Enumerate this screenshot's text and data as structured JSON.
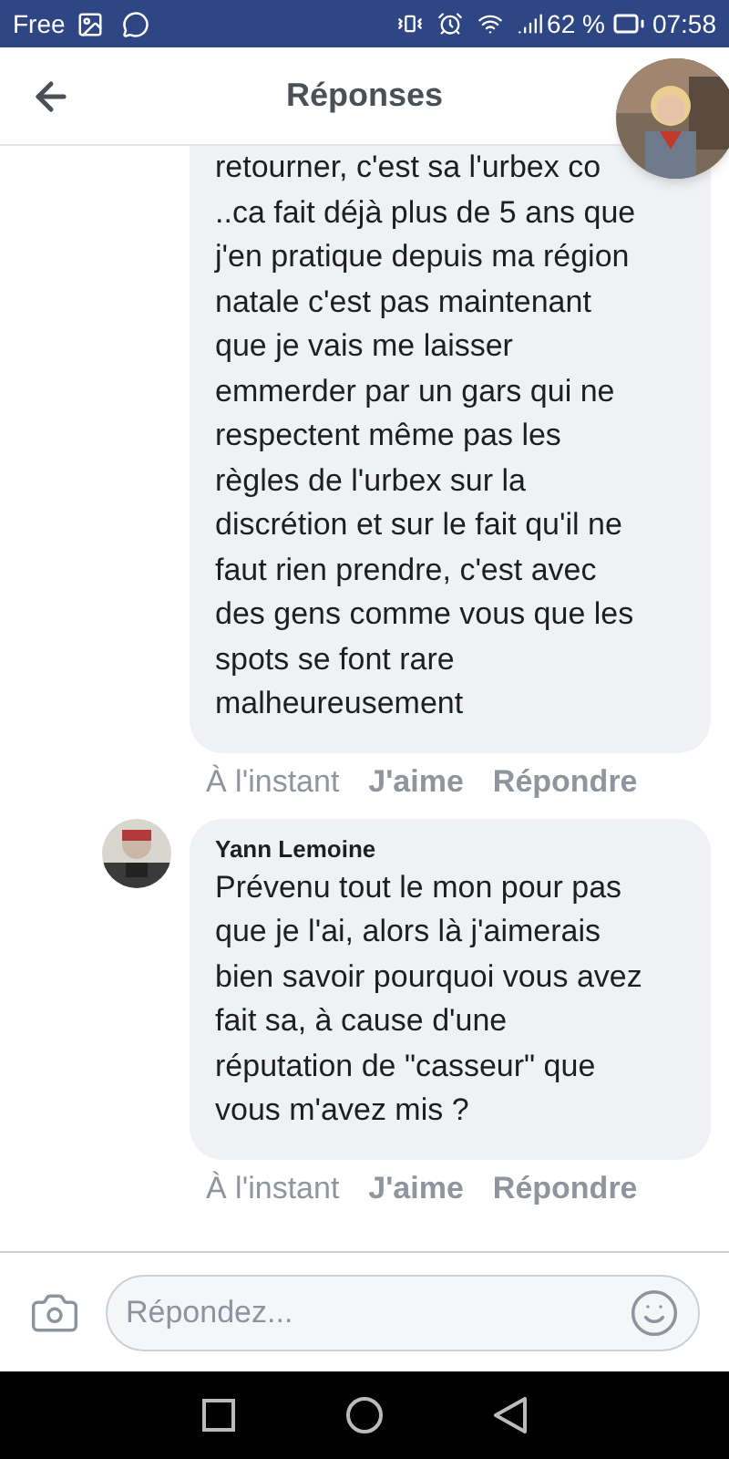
{
  "status_bar": {
    "carrier": "Free",
    "battery": "62 %",
    "time": "07:58"
  },
  "header": {
    "title": "Réponses"
  },
  "comments": [
    {
      "lines": [
        "retourner, c'est sa l'urbex co",
        "..ca fait déjà plus de 5 ans que",
        "j'en pratique depuis ma région",
        "natale c'est pas maintenant",
        "que je vais me laisser",
        "emmerder par un gars qui ne",
        "respectent même pas les",
        "règles de l'urbex sur la",
        "discrétion et sur le fait qu'il ne",
        "faut rien prendre, c'est avec",
        "des gens comme vous que les",
        "spots se font rare",
        "malheureusement"
      ],
      "time": "À l'instant",
      "like": "J'aime",
      "reply": "Répondre"
    },
    {
      "author": "Yann Lemoine",
      "lines": [
        "Prévenu tout le mon pour pas",
        "que je l'ai, alors là j'aimerais",
        "bien savoir pourquoi vous avez",
        "fait sa, à cause d'une",
        "réputation de \"casseur\" que",
        "vous m'avez mis ?"
      ],
      "time": "À l'instant",
      "like": "J'aime",
      "reply": "Répondre"
    }
  ],
  "composer": {
    "placeholder": "Répondez..."
  }
}
